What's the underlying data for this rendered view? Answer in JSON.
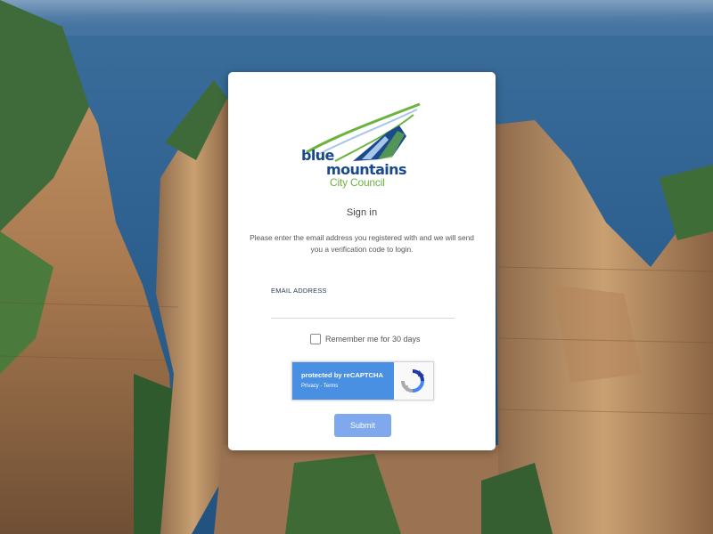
{
  "brand": {
    "line1_blue": "blue",
    "line1_mountains": "mountains",
    "line2": "City Council",
    "colors": {
      "navy": "#1b4a8c",
      "green": "#6cb33e",
      "lightblue": "#a7c7ea"
    }
  },
  "form": {
    "title": "Sign in",
    "description": "Please enter the email address you registered with and we will send you a verification code to login.",
    "email_label": "EMAIL ADDRESS",
    "email_value": "",
    "remember_label": "Remember me for 30 days",
    "remember_checked": false,
    "submit_label": "Submit"
  },
  "recaptcha": {
    "title": "protected by reCAPTCHA",
    "privacy": "Privacy",
    "separator": " - ",
    "terms": "Terms"
  },
  "icons": {
    "captcha": "recaptcha-logo-icon",
    "brand": "blue-mountains-logo-icon"
  }
}
